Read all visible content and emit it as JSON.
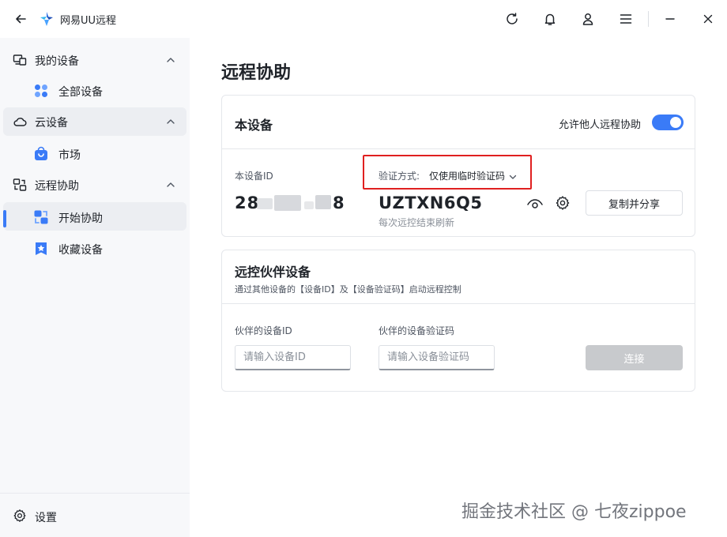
{
  "app": {
    "title": "网易UU远程"
  },
  "sidebar": {
    "groups": [
      {
        "label": "我的设备",
        "items": [
          {
            "label": "全部设备"
          }
        ]
      },
      {
        "label": "云设备",
        "items": [
          {
            "label": "市场"
          }
        ]
      },
      {
        "label": "远程协助",
        "items": [
          {
            "label": "开始协助"
          },
          {
            "label": "收藏设备"
          }
        ]
      }
    ],
    "settings_label": "设置"
  },
  "main": {
    "page_title": "远程协助",
    "this_device": {
      "title": "本设备",
      "allow_label": "允许他人远程协助",
      "allow_enabled": true,
      "device_id_label": "本设备ID",
      "device_id_prefix": "28",
      "device_id_suffix": "8",
      "auth_label": "验证方式:",
      "auth_value": "仅使用临时验证码",
      "code": "UZTXN6Q5",
      "code_hint": "每次远控结束刷新",
      "copy_share_label": "复制并分享"
    },
    "partner": {
      "title": "远控伙伴设备",
      "subtitle": "通过其他设备的【设备ID】及【设备验证码】启动远程控制",
      "id_label": "伙伴的设备ID",
      "id_placeholder": "请输入设备ID",
      "code_label": "伙伴的设备验证码",
      "code_placeholder": "请输入设备验证码",
      "connect_label": "连接"
    }
  },
  "watermark": "掘金技术社区 @ 七夜zippoe",
  "colors": {
    "accent": "#3a7bf7",
    "highlight_border": "#e02020",
    "disabled_button": "#c8cacd"
  }
}
